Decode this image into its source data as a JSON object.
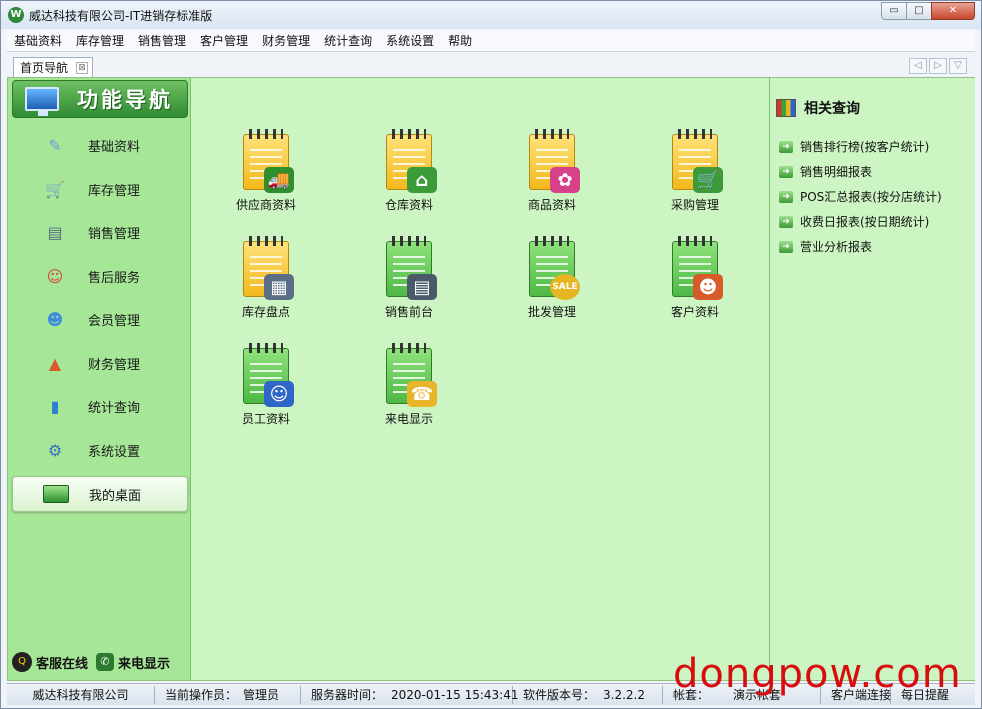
{
  "window": {
    "title": "威达科技有限公司-IT进销存标准版",
    "buttons": {
      "minimize": "▭",
      "maximize": "□",
      "close": "✕"
    }
  },
  "menubar": {
    "items": [
      "基础资料",
      "库存管理",
      "销售管理",
      "客户管理",
      "财务管理",
      "统计查询",
      "系统设置",
      "帮助"
    ]
  },
  "tabs": [
    {
      "label": "首页导航",
      "close_icon": "⊠"
    }
  ],
  "sidebar": {
    "header_title": "功能导航",
    "items": [
      {
        "label": "基础资料",
        "icon": "pencil-icon",
        "glyph": "✎",
        "color": "#6aa2e0"
      },
      {
        "label": "库存管理",
        "icon": "cart-icon",
        "glyph": "🛒",
        "color": "#f0a53a"
      },
      {
        "label": "销售管理",
        "icon": "register-icon",
        "glyph": "▤",
        "color": "#5a6f86"
      },
      {
        "label": "售后服务",
        "icon": "agent-icon",
        "glyph": "☺",
        "color": "#d7463d"
      },
      {
        "label": "会员管理",
        "icon": "members-icon",
        "glyph": "☻",
        "color": "#3e8edb"
      },
      {
        "label": "财务管理",
        "icon": "finance-chart-icon",
        "glyph": "▲",
        "color": "#d65a2a"
      },
      {
        "label": "统计查询",
        "icon": "statistics-icon",
        "glyph": "▮",
        "color": "#2f7fd1"
      },
      {
        "label": "系统设置",
        "icon": "gears-icon",
        "glyph": "⚙",
        "color": "#3570c8"
      }
    ],
    "desktop_label": "我的桌面",
    "bottom": {
      "qq_label": "客服在线",
      "phone_label": "来电显示"
    }
  },
  "main": {
    "items": [
      {
        "label": "供应商资料",
        "icon": "supplier-truck-icon",
        "pad": "yellow",
        "glyph": "🚚",
        "badge": "#2f8f2e"
      },
      {
        "label": "仓库资料",
        "icon": "warehouse-icon",
        "pad": "yellow",
        "glyph": "⌂",
        "badge": "#3b9b39"
      },
      {
        "label": "商品资料",
        "icon": "product-icon",
        "pad": "yellow",
        "glyph": "✿",
        "badge": "#d6418a"
      },
      {
        "label": "采购管理",
        "icon": "purchase-cart-icon",
        "pad": "yellow",
        "glyph": "🛒",
        "badge": "#3b9b39"
      },
      {
        "label": "库存盘点",
        "icon": "calculator-icon",
        "pad": "yellow",
        "glyph": "▦",
        "badge": "#5a6f86"
      },
      {
        "label": "销售前台",
        "icon": "cash-register-icon",
        "pad": "green",
        "glyph": "▤",
        "badge": "#4a5a6b"
      },
      {
        "label": "批发管理",
        "icon": "sale-icon",
        "pad": "green",
        "glyph": "SALE",
        "badge": "#e5b624"
      },
      {
        "label": "客户资料",
        "icon": "customers-icon",
        "pad": "green",
        "glyph": "☻",
        "badge": "#d75a2a"
      },
      {
        "label": "员工资料",
        "icon": "employees-icon",
        "pad": "green",
        "glyph": "☺",
        "badge": "#2f66c9"
      },
      {
        "label": "来电显示",
        "icon": "telephone-icon",
        "pad": "green",
        "glyph": "☎",
        "badge": "#e8b42a"
      }
    ]
  },
  "right_panel": {
    "title": "相关查询",
    "links": [
      "销售排行榜(按客户统计)",
      "销售明细报表",
      "POS汇总报表(按分店统计)",
      "收费日报表(按日期统计)",
      "营业分析报表"
    ]
  },
  "statusbar": {
    "company": "威达科技有限公司",
    "operator_label": "当前操作员：",
    "operator": "管理员",
    "server_time_label": "服务器时间：",
    "server_time": "2020-01-15 15:43:41",
    "version_label": "软件版本号：",
    "version": "3.2.2.2",
    "account_label": "帐套：",
    "account": "演示帐套",
    "client_status": "客户端连接",
    "daily_reminder": "每日提醒"
  },
  "watermark": "dongpow.com"
}
